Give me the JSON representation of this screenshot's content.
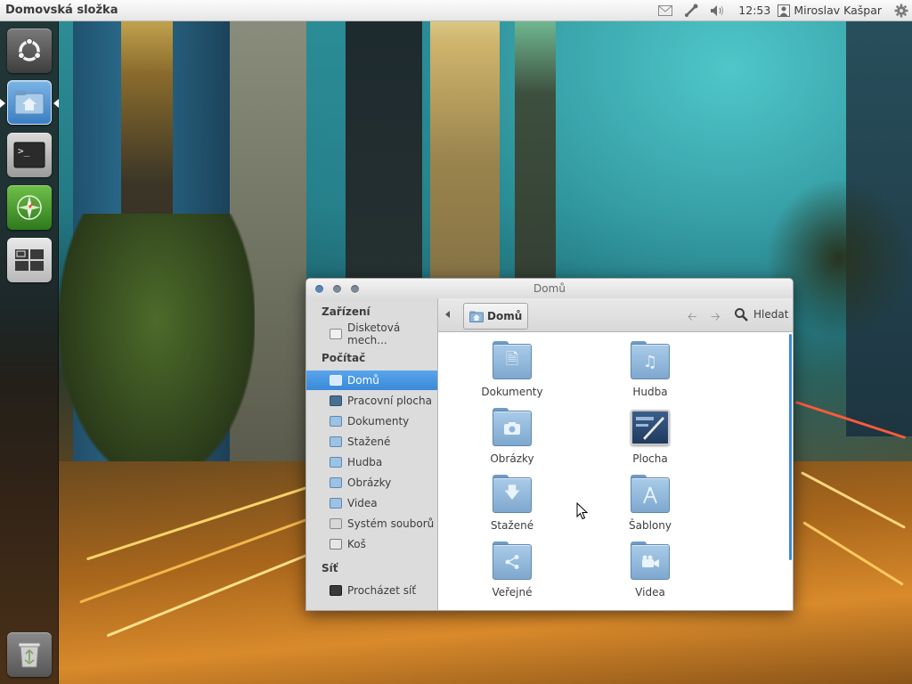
{
  "panel": {
    "title": "Domovská složka",
    "clock": "12:53",
    "user": "Miroslav Kašpar",
    "indicators": [
      "mail-icon",
      "network-icon",
      "volume-icon",
      "gear-icon"
    ]
  },
  "launcher": {
    "items": [
      {
        "name": "Dash",
        "icon": "ubuntu-logo-icon"
      },
      {
        "name": "Domovská složka",
        "icon": "home-folder-icon",
        "active": true
      },
      {
        "name": "Terminál",
        "icon": "terminal-icon"
      },
      {
        "name": "Prohlížeč",
        "icon": "compass-icon"
      },
      {
        "name": "Pracovní plochy",
        "icon": "workspaces-icon"
      },
      {
        "name": "Koš",
        "icon": "trash-icon"
      }
    ]
  },
  "window": {
    "title": "Domů",
    "toolbar": {
      "breadcrumb": "Domů",
      "search_label": "Hledat"
    },
    "sidebar": {
      "sections": [
        {
          "header": "Zařízení",
          "items": [
            {
              "label": "Disketová mech...",
              "icon": "floppy-icon"
            }
          ]
        },
        {
          "header": "Počítač",
          "items": [
            {
              "label": "Domů",
              "icon": "home-icon",
              "active": true
            },
            {
              "label": "Pracovní plocha",
              "icon": "desktop-icon"
            },
            {
              "label": "Dokumenty",
              "icon": "documents-folder-icon"
            },
            {
              "label": "Stažené",
              "icon": "downloads-folder-icon"
            },
            {
              "label": "Hudba",
              "icon": "music-folder-icon"
            },
            {
              "label": "Obrázky",
              "icon": "pictures-folder-icon"
            },
            {
              "label": "Videa",
              "icon": "videos-folder-icon"
            },
            {
              "label": "Systém souborů",
              "icon": "filesystem-icon"
            },
            {
              "label": "Koš",
              "icon": "trash-icon"
            }
          ]
        },
        {
          "header": "Síť",
          "items": [
            {
              "label": "Procházet síť",
              "icon": "network-browse-icon"
            }
          ]
        }
      ]
    },
    "files": [
      {
        "label": "Dokumenty",
        "icon": "documents-folder-icon"
      },
      {
        "label": "Hudba",
        "icon": "music-folder-icon"
      },
      {
        "label": "Obrázky",
        "icon": "pictures-folder-icon"
      },
      {
        "label": "Plocha",
        "icon": "desktop-folder-icon"
      },
      {
        "label": "Stažené",
        "icon": "downloads-folder-icon"
      },
      {
        "label": "Šablony",
        "icon": "templates-folder-icon"
      },
      {
        "label": "Veřejné",
        "icon": "public-folder-icon"
      },
      {
        "label": "Videa",
        "icon": "videos-folder-icon"
      }
    ]
  },
  "colors": {
    "selection": "#3a8ad8",
    "folder": "#8fb6da",
    "sidebar_bg": "#dcdcdc",
    "panel_bg": "#ececec"
  }
}
